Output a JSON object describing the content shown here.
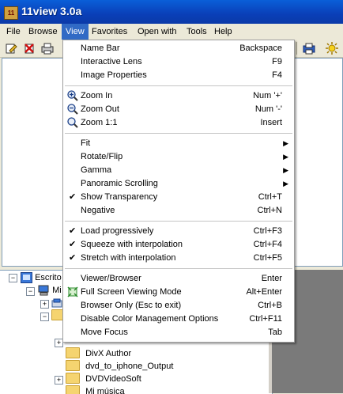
{
  "window": {
    "title": "11view 3.0a",
    "app_icon_text": "11"
  },
  "menubar": [
    {
      "label": "File"
    },
    {
      "label": "Browse"
    },
    {
      "label": "View",
      "active": true
    },
    {
      "label": "Favorites"
    },
    {
      "label": "Open with"
    },
    {
      "label": "Tools"
    },
    {
      "label": "Help"
    }
  ],
  "view_menu": {
    "items": [
      {
        "label": "Name Bar",
        "shortcut": "Backspace"
      },
      {
        "label": "Interactive Lens",
        "shortcut": "F9"
      },
      {
        "label": "Image Properties",
        "shortcut": "F4"
      },
      {
        "label": "Zoom In",
        "shortcut": "Num '+'",
        "icon": "zoom-in-icon"
      },
      {
        "label": "Zoom Out",
        "shortcut": "Num '-'",
        "icon": "zoom-out-icon"
      },
      {
        "label": "Zoom 1:1",
        "shortcut": "Insert",
        "icon": "zoom-actual-icon"
      },
      {
        "label": "Fit",
        "submenu": true
      },
      {
        "label": "Rotate/Flip",
        "submenu": true
      },
      {
        "label": "Gamma",
        "submenu": true
      },
      {
        "label": "Panoramic Scrolling",
        "submenu": true
      },
      {
        "label": "Show Transparency",
        "shortcut": "Ctrl+T",
        "checked": true
      },
      {
        "label": "Negative",
        "shortcut": "Ctrl+N"
      },
      {
        "label": "Load progressively",
        "shortcut": "Ctrl+F3",
        "checked": true
      },
      {
        "label": "Squeeze with interpolation",
        "shortcut": "Ctrl+F4",
        "checked": true
      },
      {
        "label": "Stretch with interpolation",
        "shortcut": "Ctrl+F5",
        "checked": true
      },
      {
        "label": "Viewer/Browser",
        "shortcut": "Enter"
      },
      {
        "label": "Full Screen Viewing Mode",
        "shortcut": "Alt+Enter",
        "icon": "fullscreen-icon"
      },
      {
        "label": "Browser Only (Esc to exit)",
        "shortcut": "Ctrl+B"
      },
      {
        "label": "Disable Color Management Options",
        "shortcut": "Ctrl+F11"
      },
      {
        "label": "Move Focus",
        "shortcut": "Tab"
      }
    ],
    "check_glyph": "✔",
    "submenu_glyph": "▶"
  },
  "tree": {
    "items": [
      {
        "label": "Escrito"
      },
      {
        "label": "Mi"
      },
      {
        "label": ""
      },
      {
        "label": ""
      },
      {
        "label": "DivX Author"
      },
      {
        "label": "dvd_to_iphone_Output"
      },
      {
        "label": "DVDVideoSoft"
      },
      {
        "label": "Mi música"
      }
    ]
  },
  "colors": {
    "menu_highlight": "#316ac5",
    "titlebar": "#0a4fc8"
  }
}
